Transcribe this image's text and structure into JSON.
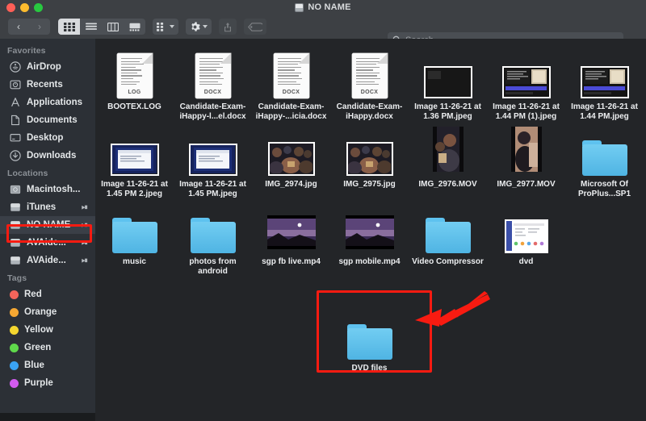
{
  "window": {
    "title": "NO NAME",
    "traffic_lights": [
      "close-red",
      "minimize-yellow",
      "maximize-green"
    ]
  },
  "toolbar": {
    "back_glyph": "‹",
    "forward_glyph": "›",
    "view_modes": [
      {
        "name": "icon-view",
        "active": true
      },
      {
        "name": "list-view",
        "active": false
      },
      {
        "name": "column-view",
        "active": false
      },
      {
        "name": "gallery-view",
        "active": false
      }
    ],
    "group_button": "group-by-button",
    "action_button": "action-gear-button",
    "share_button": "share-button",
    "tags_button": "tags-button",
    "search": {
      "placeholder": "Search",
      "value": ""
    }
  },
  "sidebar": {
    "sections": [
      {
        "header": "Favorites",
        "items": [
          {
            "label": "AirDrop",
            "icon": "airdrop-icon",
            "eject": false
          },
          {
            "label": "Recents",
            "icon": "recents-icon",
            "eject": false
          },
          {
            "label": "Applications",
            "icon": "applications-icon",
            "eject": false
          },
          {
            "label": "Documents",
            "icon": "documents-icon",
            "eject": false
          },
          {
            "label": "Desktop",
            "icon": "desktop-icon",
            "eject": false
          },
          {
            "label": "Downloads",
            "icon": "downloads-icon",
            "eject": false
          }
        ]
      },
      {
        "header": "Locations",
        "items": [
          {
            "label": "Macintosh...",
            "icon": "harddisk-icon",
            "eject": false
          },
          {
            "label": "iTunes",
            "icon": "disk-icon",
            "eject": true
          },
          {
            "label": "NO NAME",
            "icon": "disk-icon",
            "eject": true,
            "selected": true,
            "highlighted": true
          },
          {
            "label": "AVAide...",
            "icon": "disk-icon",
            "eject": true
          },
          {
            "label": "AVAide...",
            "icon": "disk-icon",
            "eject": true
          }
        ]
      },
      {
        "header": "Tags",
        "items": [
          {
            "label": "Red",
            "color": "#f4655b"
          },
          {
            "label": "Orange",
            "color": "#f6a833"
          },
          {
            "label": "Yellow",
            "color": "#f4d62f"
          },
          {
            "label": "Green",
            "color": "#5fd94b"
          },
          {
            "label": "Blue",
            "color": "#3aa3f4"
          },
          {
            "label": "Purple",
            "color": "#d35bf0"
          }
        ]
      }
    ]
  },
  "files": {
    "rows": [
      [
        {
          "name": "BOOTEX.LOG",
          "kind": "document",
          "ext": "LOG"
        },
        {
          "name": "Candidate-Exam-iHappy-l...el.docx",
          "kind": "document",
          "ext": "DOCX"
        },
        {
          "name": "Candidate-Exam-iHappy-...icia.docx",
          "kind": "document",
          "ext": "DOCX"
        },
        {
          "name": "Candidate-Exam-iHappy.docx",
          "kind": "document",
          "ext": "DOCX"
        },
        {
          "name": "Image 11-26-21 at 1.36 PM.jpeg",
          "kind": "image-dark"
        },
        {
          "name": "Image 11-26-21 at 1.44 PM (1).jpeg",
          "kind": "image-screenshot"
        },
        {
          "name": "Image 11-26-21 at 1.44 PM.jpeg",
          "kind": "image-screenshot"
        }
      ],
      [
        {
          "name": "Image 11-26-21 at 1.45 PM 2.jpeg",
          "kind": "image-blue"
        },
        {
          "name": "Image 11-26-21 at 1.45 PM.jpeg",
          "kind": "image-blue"
        },
        {
          "name": "IMG_2974.jpg",
          "kind": "photo-group"
        },
        {
          "name": "IMG_2975.jpg",
          "kind": "photo-group"
        },
        {
          "name": "IMG_2976.MOV",
          "kind": "movie-portrait"
        },
        {
          "name": "IMG_2977.MOV",
          "kind": "movie-portrait"
        },
        {
          "name": "Microsoft Of ProPlus...SP1",
          "kind": "folder"
        }
      ],
      [
        {
          "name": "music",
          "kind": "folder"
        },
        {
          "name": "photos from android",
          "kind": "folder"
        },
        {
          "name": "sgp fb live.mp4",
          "kind": "video-sunset"
        },
        {
          "name": "sgp mobile.mp4",
          "kind": "video-sunset"
        },
        {
          "name": "Video Compressor",
          "kind": "folder"
        },
        {
          "name": "dvd",
          "kind": "image-document"
        }
      ],
      [
        {
          "name": "DVD files",
          "kind": "folder",
          "annotated": true
        }
      ]
    ]
  },
  "annotations": {
    "highlight_color": "#f81b11",
    "arrow_color": "#f81b11",
    "boxes": [
      {
        "name": "sidebar-no-name-highlight",
        "target": "NO NAME"
      },
      {
        "name": "dvd-files-highlight",
        "target": "DVD files"
      }
    ],
    "arrow": {
      "name": "pointer-arrow",
      "points_to": "DVD files"
    }
  }
}
